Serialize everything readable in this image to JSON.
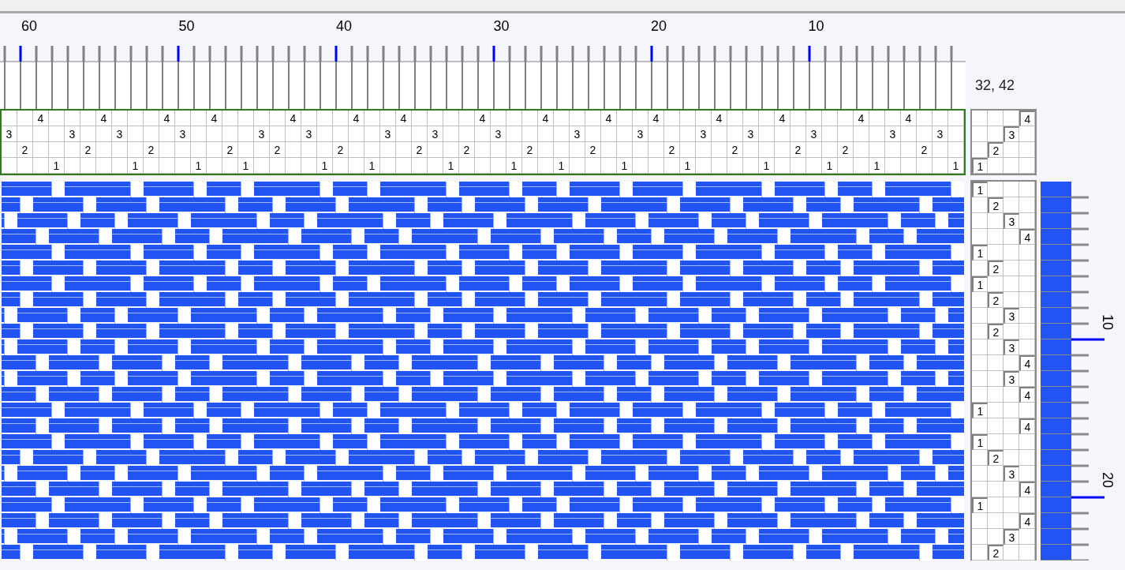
{
  "warp_ruler": {
    "labels": [
      "60",
      "50",
      "40",
      "30",
      "20",
      "10"
    ]
  },
  "cursor_position": "32, 42",
  "threading": [
    "3",
    "2",
    "4",
    "1",
    "3",
    "2",
    "4",
    "3",
    "1",
    "2",
    "4",
    "3",
    "1",
    "4",
    "2",
    "1",
    "3",
    "2",
    "4",
    "3",
    "1",
    "2",
    "4",
    "1",
    "3",
    "4",
    "2",
    "3",
    "1",
    "2",
    "4",
    "3",
    "1",
    "2",
    "4",
    "1",
    "3",
    "2",
    "4",
    "1",
    "3",
    "4",
    "2",
    "1",
    "3",
    "4",
    "2",
    "3",
    "1",
    "4",
    "2",
    "3",
    "1",
    "2",
    "4",
    "1",
    "3",
    "4",
    "2",
    "3",
    "1"
  ],
  "tie_up": [
    [
      {
        "tied": false
      },
      {
        "tied": false
      },
      {
        "tied": false
      },
      {
        "tied": true,
        "label": "4"
      }
    ],
    [
      {
        "tied": false
      },
      {
        "tied": false
      },
      {
        "tied": true,
        "label": "3"
      },
      {
        "tied": false
      }
    ],
    [
      {
        "tied": false
      },
      {
        "tied": true,
        "label": "2"
      },
      {
        "tied": false
      },
      {
        "tied": false
      }
    ],
    [
      {
        "tied": true,
        "label": "1"
      },
      {
        "tied": false
      },
      {
        "tied": false
      },
      {
        "tied": false
      }
    ]
  ],
  "treadling": [
    "1",
    "2",
    "3",
    "4",
    "1",
    "2",
    "1",
    "2",
    "3",
    "2",
    "3",
    "4",
    "3",
    "4",
    "1",
    "4",
    "1",
    "2",
    "3",
    "4",
    "1",
    "4",
    "3",
    "2"
  ],
  "weft_ruler": {
    "labels": [
      "10",
      "20"
    ]
  }
}
